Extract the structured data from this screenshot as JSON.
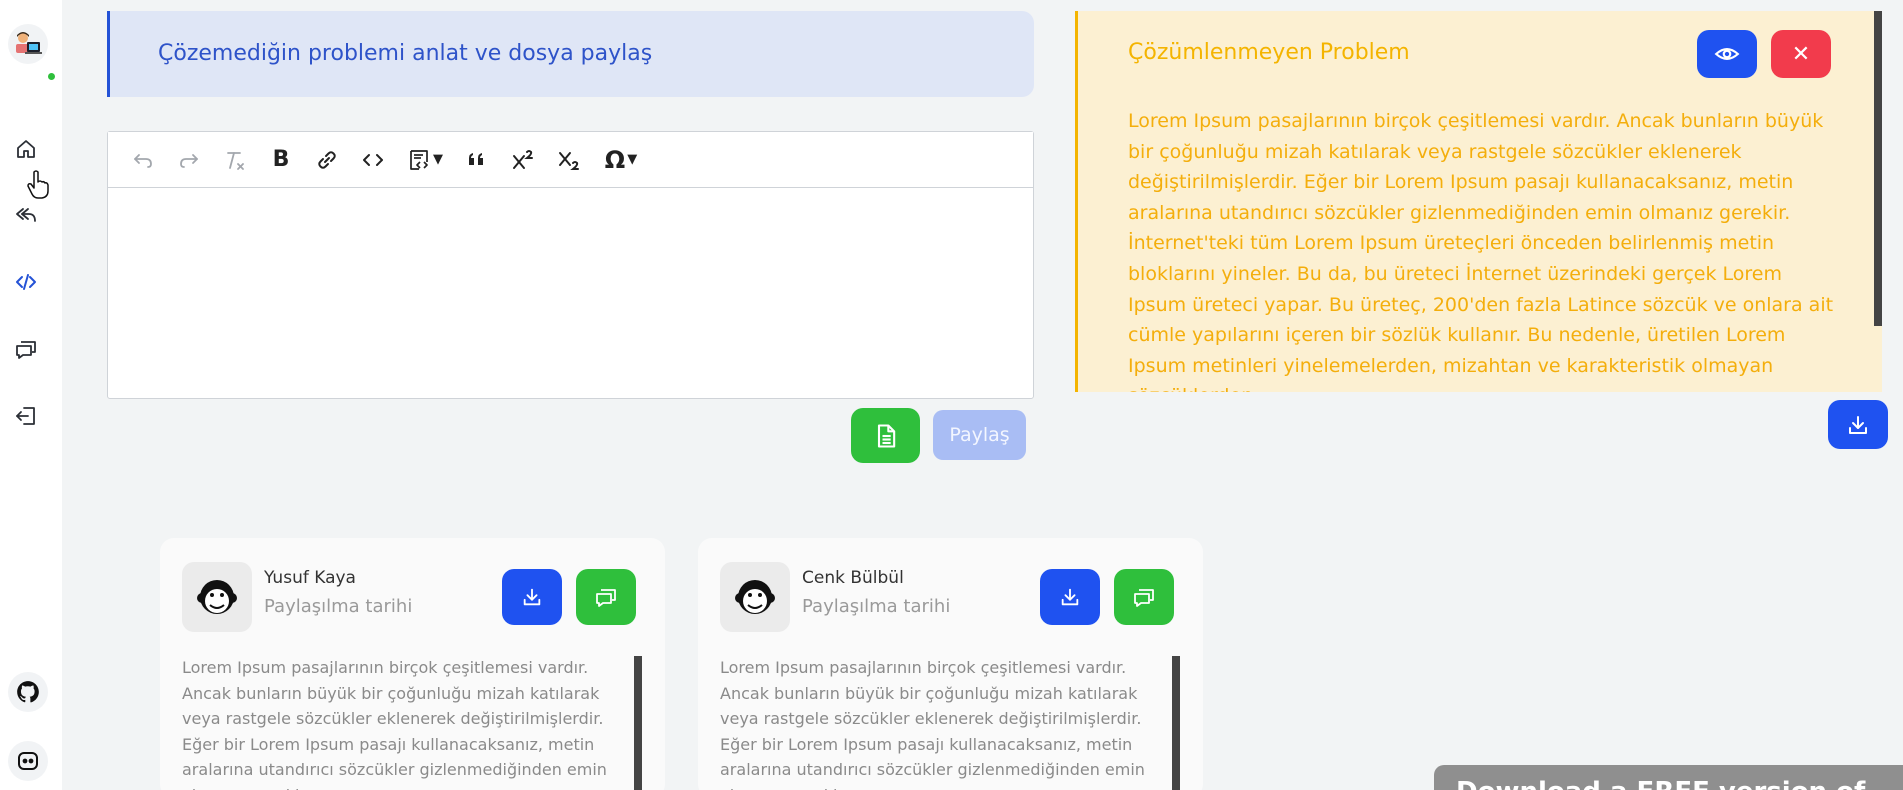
{
  "sidebar": {
    "items": [
      {
        "name": "home",
        "icon": "home-icon"
      },
      {
        "name": "back",
        "icon": "reply-icon"
      },
      {
        "name": "code",
        "icon": "code-icon",
        "active": true
      },
      {
        "name": "messages",
        "icon": "chat-icon"
      },
      {
        "name": "logout",
        "icon": "logout-icon"
      }
    ],
    "bottom": [
      {
        "name": "github",
        "icon": "github-icon"
      },
      {
        "name": "discord",
        "icon": "discord-icon"
      }
    ],
    "online_color": "#2fbf3c"
  },
  "header": {
    "title": "Çözemediğin problemi anlat ve dosya paylaş"
  },
  "editor": {
    "toolbar": [
      "undo-icon",
      "redo-icon",
      "clear-format-icon",
      "bold-icon",
      "link-icon",
      "code-icon",
      "code-block-icon",
      "quote-icon",
      "superscript-icon",
      "subscript-icon",
      "special-char-icon"
    ],
    "content": ""
  },
  "actions": {
    "share_label": "Paylaş"
  },
  "problem": {
    "title": "Çözümlenmeyen Problem",
    "text": "Lorem Ipsum pasajlarının birçok çeşitlemesi vardır. Ancak bunların büyük bir çoğunluğu mizah katılarak veya rastgele sözcükler eklenerek değiştirilmişlerdir. Eğer bir Lorem Ipsum pasajı kullanacaksanız, metin aralarına utandırıcı sözcükler gizlenmediğinden emin olmanız gerekir. İnternet'teki tüm Lorem Ipsum üreteçleri önceden belirlenmiş metin bloklarını yineler. Bu da, bu üreteci İnternet üzerindeki gerçek Lorem Ipsum üreteci yapar. Bu üreteç, 200'den fazla Latince sözcük ve onlara ait cümle yapılarını içeren bir sözlük kullanır. Bu nedenle, üretilen Lorem Ipsum metinleri yinelemelerden, mizahtan ve karakteristik olmayan sözcüklerden",
    "accent": "#f4b400"
  },
  "cards": [
    {
      "name": "Yusuf Kaya",
      "date_label": "Paylaşılma tarihi",
      "text": "Lorem Ipsum pasajlarının birçok çeşitlemesi vardır. Ancak bunların büyük bir çoğunluğu mizah katılarak veya rastgele sözcükler eklenerek değiştirilmişlerdir. Eğer bir Lorem Ipsum pasajı kullanacaksanız, metin aralarına utandırıcı sözcükler gizlenmediğinden emin olmanız gerekir."
    },
    {
      "name": "Cenk Bülbül",
      "date_label": "Paylaşılma tarihi",
      "text": "Lorem Ipsum pasajlarının birçok çeşitlemesi vardır. Ancak bunların büyük bir çoğunluğu mizah katılarak veya rastgele sözcükler eklenerek değiştirilmişlerdir. Eğer bir Lorem Ipsum pasajı kullanacaksanız, metin aralarına utandırıcı sözcükler gizlenmediğinden emin olmanız gerekir."
    }
  ],
  "overlay": {
    "text": "Download a FREE version of"
  },
  "colors": {
    "primary": "#1f52f0",
    "success": "#2fbf3c",
    "danger": "#f23b4c"
  }
}
